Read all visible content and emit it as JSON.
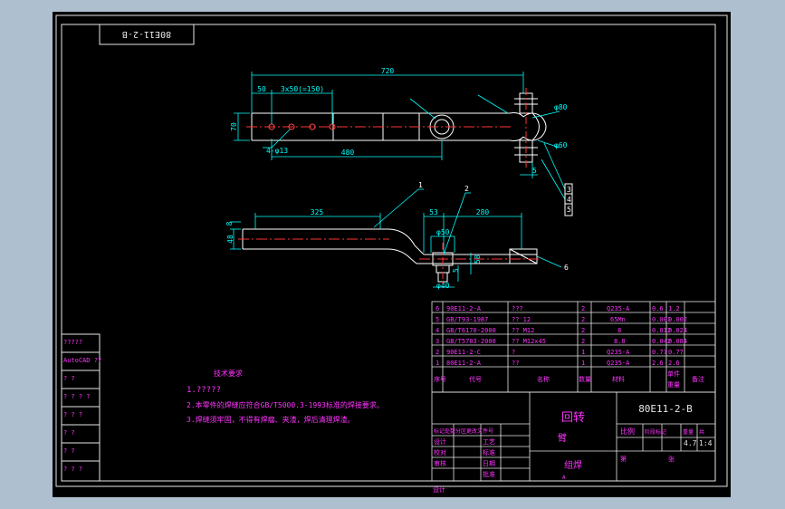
{
  "colors": {
    "background": "#000000",
    "frame": "#e6e6e6",
    "frame_inner": "#00e6e6",
    "part": "#ffffff",
    "dimension": "#00ffff",
    "centerline": "#ff3333",
    "hole": "#ff4444",
    "text_table": "#ff33ff",
    "leader": "#00ffff",
    "viewport_border": "#aebfcf"
  },
  "drawing_number_box": "80E11-2-B",
  "top_view": {
    "overall_length": "720",
    "dim_50": "50",
    "dim_pitch": "3x50(=150)",
    "dim_width": "70",
    "holes_label": "4-φ13",
    "dim_480": "480",
    "dia_80": "φ80",
    "dia_60": "φ60",
    "dim_5": "5",
    "balloons": [
      "3",
      "4",
      "5"
    ]
  },
  "front_view": {
    "dim_325": "325",
    "dim_53": "53",
    "dim_280": "280",
    "dim_height": "48",
    "dim_8": "8",
    "dia_50": "φ50",
    "dia_40": "φ40",
    "dim_5": "5",
    "dim_58": "58",
    "balloons": [
      "1",
      "2",
      "6"
    ]
  },
  "bom": {
    "rows": [
      {
        "no": "6",
        "code": "90E11-2-A",
        "name": "???",
        "qty": "2",
        "material": "Q235-A",
        "unit_weight": "0.6",
        "total_weight": "1.2"
      },
      {
        "no": "5",
        "code": "GB/T93-1987",
        "name": "?? 12",
        "qty": "2",
        "material": "65Mn",
        "unit_weight": "0.001",
        "total_weight": "0.002"
      },
      {
        "no": "4",
        "code": "GB/T6170-2000",
        "name": "?? M12",
        "qty": "2",
        "material": "8",
        "unit_weight": "0.012",
        "total_weight": "0.024"
      },
      {
        "no": "3",
        "code": "GB/T5783-2000",
        "name": "?? M12x45",
        "qty": "2",
        "material": "8.8",
        "unit_weight": "0.042",
        "total_weight": "0.084"
      },
      {
        "no": "2",
        "code": "90E11-2-C",
        "name": "?",
        "qty": "1",
        "material": "Q235-A",
        "unit_weight": "0.77",
        "total_weight": "0.77"
      },
      {
        "no": "1",
        "code": "80E11-2-A",
        "name": "??",
        "qty": "1",
        "material": "Q235-A",
        "unit_weight": "2.6",
        "total_weight": "2.6"
      }
    ],
    "header": {
      "no": "序号",
      "code": "代号",
      "name": "名称",
      "qty": "数量",
      "material": "材料",
      "weight_1": "单件",
      "weight_2": "重量",
      "remark": "备注"
    }
  },
  "notes": {
    "title": "技术要求",
    "lines": [
      "1.?????",
      "2.本零件的焊缝应符合GB/T5000.3-1993标准的焊接要求。",
      "3.焊缝须牢固，不得有焊瘤、夹渣，焊后清理焊渣。"
    ]
  },
  "title_block": {
    "part_name_1": "回转",
    "part_name_2": "臂",
    "drawing_code": "80E11-2-B",
    "company": "组焊",
    "sub_label": "A",
    "scale_label": "比例",
    "stage_label": "阶段标记",
    "weight_label": "重量",
    "count_label": "共",
    "weight_value": "4.7",
    "scale_value": "1:4",
    "sheet_label": "第",
    "page_label": "张",
    "designer": "设计",
    "checker": "校对",
    "reviewer": "审核",
    "craft": "工艺",
    "standard": "标准",
    "approve": "批准",
    "date": "日期",
    "sign_row": "标记处数分区更改文件号",
    "design_label": "设计"
  },
  "left_strip": [
    "?????",
    "AutoCAD ??",
    "? ?",
    "? ? ? ?",
    "? ? ?",
    "? ?",
    "? ?",
    "? ? ?"
  ]
}
